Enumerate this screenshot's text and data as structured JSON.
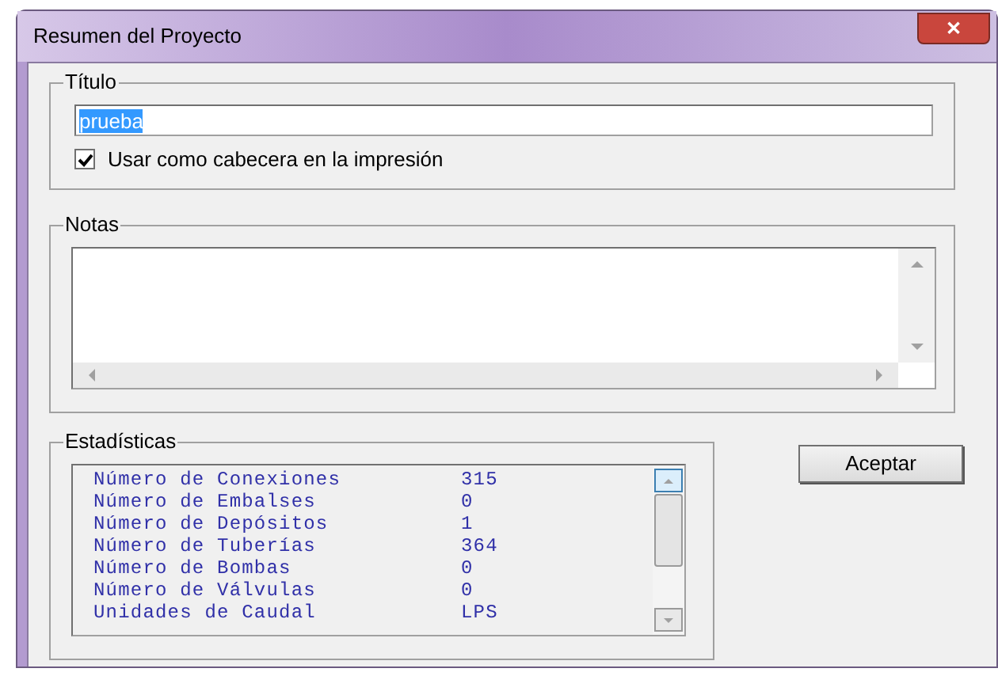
{
  "window": {
    "title": "Resumen del Proyecto",
    "close": "✕"
  },
  "title_group": {
    "label": "Título",
    "value": "prueba",
    "value_selected": true,
    "checkbox": {
      "label": "Usar como cabecera en la impresión",
      "checked": true
    }
  },
  "notes_group": {
    "label": "Notas"
  },
  "stats_group": {
    "label": "Estadísticas",
    "rows": [
      {
        "name": "Número de Conexiones",
        "value": "315"
      },
      {
        "name": "Número de Embalses",
        "value": "0"
      },
      {
        "name": "Número de Depósitos",
        "value": "1"
      },
      {
        "name": "Número de Tuberías",
        "value": "364"
      },
      {
        "name": "Número de Bombas",
        "value": "0"
      },
      {
        "name": "Número de Válvulas",
        "value": "0"
      },
      {
        "name": "Unidades de Caudal",
        "value": "LPS"
      }
    ]
  },
  "buttons": [
    "Aceptar"
  ]
}
